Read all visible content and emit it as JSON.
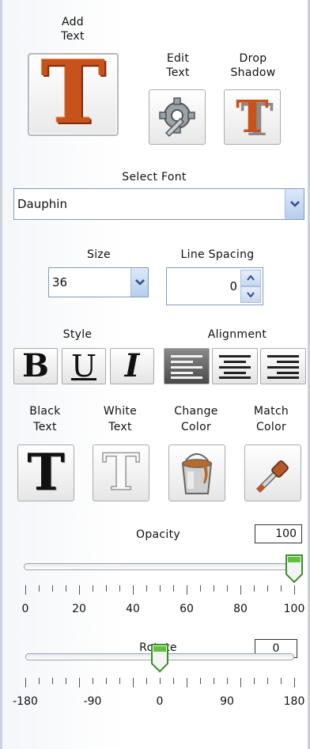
{
  "add_text": {
    "label_line1": "Add",
    "label_line2": "Text"
  },
  "edit_text": {
    "label_line1": "Edit",
    "label_line2": "Text"
  },
  "drop_shadow": {
    "label_line1": "Drop",
    "label_line2": "Shadow"
  },
  "font": {
    "label": "Select Font",
    "value": "Dauphin"
  },
  "size": {
    "label": "Size",
    "value": "36"
  },
  "line_spacing": {
    "label": "Line Spacing",
    "value": "0"
  },
  "style": {
    "label": "Style",
    "bold": "B",
    "underline": "U",
    "italic": "I"
  },
  "alignment": {
    "label": "Alignment"
  },
  "black_text": {
    "label_line1": "Black",
    "label_line2": "Text"
  },
  "white_text": {
    "label_line1": "White",
    "label_line2": "Text"
  },
  "change_color": {
    "label_line1": "Change",
    "label_line2": "Color"
  },
  "match_color": {
    "label_line1": "Match",
    "label_line2": "Color"
  },
  "opacity": {
    "label": "Opacity",
    "value": "100",
    "level": 100,
    "ticks": [
      "0",
      "20",
      "40",
      "60",
      "80",
      "100"
    ]
  },
  "rotate": {
    "label": "Rotate",
    "value": "0",
    "level": 0,
    "ticks": [
      "-180",
      "-90",
      "0",
      "90",
      "180"
    ]
  },
  "colors": {
    "text_orange": "#c8521c",
    "accent_blue": "#7f9db9",
    "thumb_green": "#3fae2a"
  },
  "icons": [
    "big-T-icon",
    "gear-wrench-icon",
    "shadow-T-icon",
    "bold-icon",
    "underline-icon",
    "italic-icon",
    "align-left-icon",
    "align-center-icon",
    "align-right-icon",
    "black-T-icon",
    "white-T-icon",
    "paint-bucket-icon",
    "eyedropper-icon",
    "chevron-down-icon",
    "spin-up-icon",
    "spin-down-icon"
  ]
}
